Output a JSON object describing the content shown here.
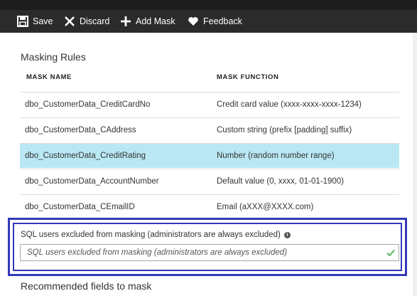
{
  "toolbar": {
    "buttons": [
      {
        "label": "Save",
        "icon": "save-icon"
      },
      {
        "label": "Discard",
        "icon": "close-icon"
      },
      {
        "label": "Add Mask",
        "icon": "plus-icon"
      },
      {
        "label": "Feedback",
        "icon": "heart-icon"
      }
    ]
  },
  "masking_rules": {
    "title": "Masking Rules",
    "columns": [
      "MASK NAME",
      "MASK FUNCTION"
    ],
    "rows": [
      {
        "name": "dbo_CustomerData_CreditCardNo",
        "function": "Credit card value (xxxx-xxxx-xxxx-1234)",
        "selected": false
      },
      {
        "name": "dbo_CustomerData_CAddress",
        "function": "Custom string (prefix [padding] suffix)",
        "selected": false
      },
      {
        "name": "dbo_CustomerData_CreditRating",
        "function": "Number (random number range)",
        "selected": true
      },
      {
        "name": "dbo_CustomerData_AccountNumber",
        "function": "Default value (0, xxxx, 01-01-1900)",
        "selected": false
      },
      {
        "name": "dbo_CustomerData_CEmailID",
        "function": "Email (aXXX@XXXX.com)",
        "selected": false
      }
    ],
    "selected_row_color": "#b9e8f4"
  },
  "excluded_users": {
    "label": "SQL users excluded from masking (administrators are always excluded)",
    "placeholder": "SQL users excluded from masking (administrators are always excluded)",
    "value": "",
    "info_icon": "info-icon",
    "valid_icon": "check-icon"
  },
  "recommended": {
    "title": "Recommended fields to mask"
  },
  "colors": {
    "toolbar_bg": "#2b2b2b",
    "highlight_border": "#3338b8",
    "check_green": "#5cb85c"
  }
}
